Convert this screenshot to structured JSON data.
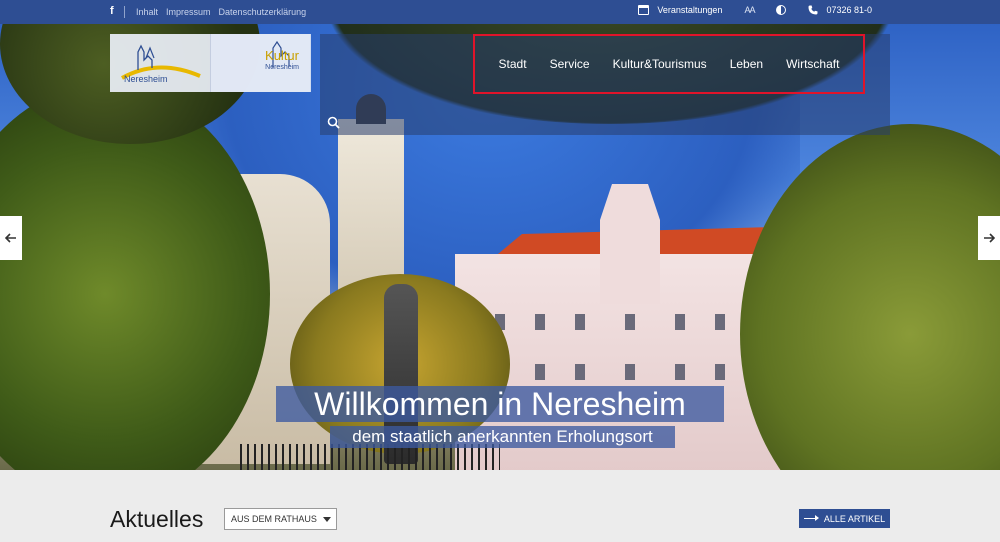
{
  "topbar": {
    "facebook_icon": "f",
    "links": [
      "Inhalt",
      "Impressum",
      "Datenschutzerklärung"
    ],
    "events_label": "Veranstaltungen",
    "font_size_label": "AA",
    "phone": "07326 81-0"
  },
  "logo": {
    "city_name": "Neresheim",
    "kultur_title": "Kultur",
    "kultur_sub": "Neresheim"
  },
  "nav": {
    "items": [
      "Stadt",
      "Service",
      "Kultur&Tourismus",
      "Leben",
      "Wirtschaft"
    ]
  },
  "hero": {
    "headline": "Willkommen in Neresheim",
    "subline": "dem staatlich anerkannten Erholungsort"
  },
  "news": {
    "title": "Aktuelles",
    "filter_selected": "AUS DEM RATHAUS",
    "all_button": "ALLE ARTIKEL"
  },
  "colors": {
    "brand_blue": "#2e4e93",
    "highlight_red": "#e0142a",
    "logo_yellow": "#c8a000"
  }
}
